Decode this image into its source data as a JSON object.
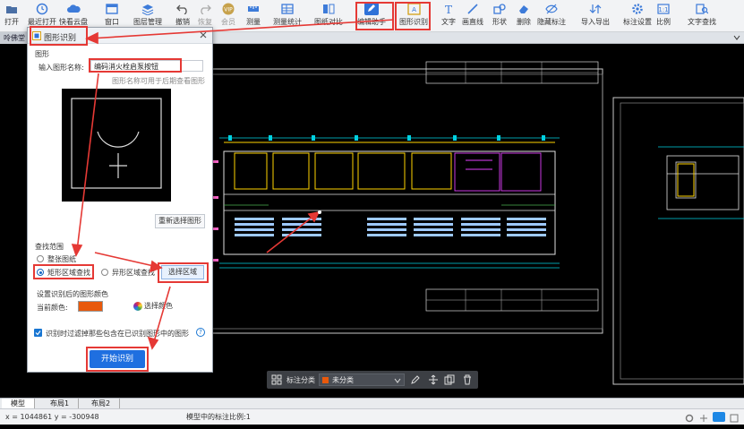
{
  "toolbar": {
    "items": [
      {
        "label": "打开"
      },
      {
        "label": "最近打开"
      },
      {
        "label": "快看云盘"
      },
      {
        "label": "窗口"
      },
      {
        "label": "图层管理"
      },
      {
        "label": "撤销"
      },
      {
        "label": "恢复"
      },
      {
        "label": "会员"
      },
      {
        "label": "测量"
      },
      {
        "label": "测量统计"
      },
      {
        "label": "图纸对比"
      },
      {
        "label": "编辑助手"
      },
      {
        "label": "图形识别"
      },
      {
        "label": "文字"
      },
      {
        "label": "画直线"
      },
      {
        "label": "形状"
      },
      {
        "label": "删除"
      },
      {
        "label": "隐藏标注"
      },
      {
        "label": "导入导出"
      },
      {
        "label": "标注设置"
      },
      {
        "label": "比例"
      },
      {
        "label": "文字查找"
      }
    ]
  },
  "document_tab": {
    "label": "呤佛堂"
  },
  "dialog": {
    "title": "图形识别",
    "section_shape": "图形",
    "name_label": "输入图形名称:",
    "name_value": "编码消火栓启泵按钮",
    "name_hint": "图形名称可用于后期查看图形",
    "reselect_label": "重新选择图形",
    "search_scope_label": "查找范围",
    "scope_options": [
      {
        "label": "整张图纸",
        "selected": false
      },
      {
        "label": "矩形区域查找",
        "selected": true
      },
      {
        "label": "异形区域查找",
        "selected": false
      }
    ],
    "select_area_label": "选择区域",
    "color_section_label": "设置识别后的图形颜色",
    "current_color_label": "当前颜色:",
    "current_color": "#e8590c",
    "choose_color_label": "选择颜色",
    "filter_label": "识别时过滤掉那些包含在已识别图形中的图形",
    "filter_checked": true,
    "start_label": "开始识别"
  },
  "float_toolbar": {
    "label": "标注分类",
    "category_value": "未分类"
  },
  "layout_tabs": [
    {
      "label": "模型",
      "active": true
    },
    {
      "label": "布局1",
      "active": false
    },
    {
      "label": "布局2",
      "active": false
    }
  ],
  "status": {
    "coords": "x = 1044861 y = -300948",
    "scale_text": "模型中的标注比例:1"
  },
  "colors": {
    "highlight": "#e53935",
    "accent": "#1976d2",
    "cad_background": "#000000"
  }
}
